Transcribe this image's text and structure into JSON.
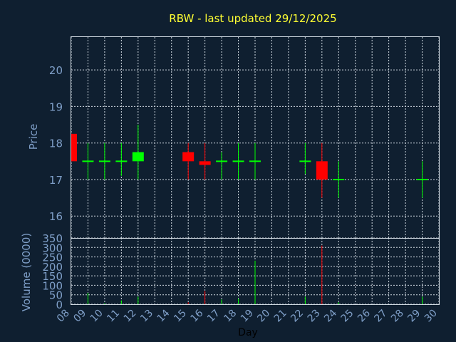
{
  "chart_data": {
    "type": "candlestick",
    "title": "RBW - last updated 29/12/2025",
    "colors": {
      "background": "#0f1f30",
      "up": "#00ff00",
      "down": "#ff0000",
      "doji": "#00ff00",
      "title": "#ffff33",
      "labels": "#7f9fc8",
      "grid": "#cfd8e0"
    },
    "grid": true,
    "price_panel": {
      "ylabel": "Price",
      "ylim": [
        15.4,
        20.9
      ],
      "yticks": [
        16,
        17,
        18,
        19,
        20
      ]
    },
    "volume_panel": {
      "ylabel": "Volume (0000)",
      "ylim": [
        0,
        350
      ],
      "yticks": [
        0,
        50,
        100,
        150,
        200,
        250,
        300,
        350
      ]
    },
    "x_axis": {
      "xlabel": "Day",
      "ticks": [
        "08",
        "09",
        "10",
        "11",
        "12",
        "13",
        "14",
        "15",
        "16",
        "17",
        "18",
        "19",
        "20",
        "21",
        "22",
        "23",
        "24",
        "25",
        "26",
        "27",
        "28",
        "29",
        "30"
      ]
    },
    "candles": [
      {
        "day": "08",
        "open": 18.25,
        "high": 18.25,
        "low": 17.5,
        "close": 17.5,
        "volume": 0
      },
      {
        "day": "09",
        "open": 17.5,
        "high": 18.0,
        "low": 17.0,
        "close": 17.5,
        "volume": 60
      },
      {
        "day": "10",
        "open": 17.5,
        "high": 18.0,
        "low": 17.0,
        "close": 17.5,
        "volume": 5
      },
      {
        "day": "11",
        "open": 17.5,
        "high": 18.0,
        "low": 17.1,
        "close": 17.5,
        "volume": 20
      },
      {
        "day": "12",
        "open": 17.5,
        "high": 18.5,
        "low": 17.0,
        "close": 17.75,
        "volume": 40
      },
      {
        "day": "15",
        "open": 17.75,
        "high": 18.0,
        "low": 17.0,
        "close": 17.5,
        "volume": 10
      },
      {
        "day": "16",
        "open": 17.5,
        "high": 18.0,
        "low": 17.0,
        "close": 17.4,
        "volume": 70
      },
      {
        "day": "17",
        "open": 17.5,
        "high": 17.75,
        "low": 17.0,
        "close": 17.5,
        "volume": 25
      },
      {
        "day": "18",
        "open": 17.5,
        "high": 18.0,
        "low": 17.0,
        "close": 17.5,
        "volume": 30
      },
      {
        "day": "19",
        "open": 17.5,
        "high": 18.0,
        "low": 17.0,
        "close": 17.5,
        "volume": 230
      },
      {
        "day": "22",
        "open": 17.5,
        "high": 18.0,
        "low": 17.15,
        "close": 17.5,
        "volume": 40
      },
      {
        "day": "23",
        "open": 17.5,
        "high": 18.0,
        "low": 16.5,
        "close": 17.0,
        "volume": 310
      },
      {
        "day": "24",
        "open": 17.0,
        "high": 17.5,
        "low": 16.5,
        "close": 17.0,
        "volume": 10
      },
      {
        "day": "29",
        "open": 17.0,
        "high": 17.5,
        "low": 16.5,
        "close": 17.0,
        "volume": 40
      }
    ]
  }
}
